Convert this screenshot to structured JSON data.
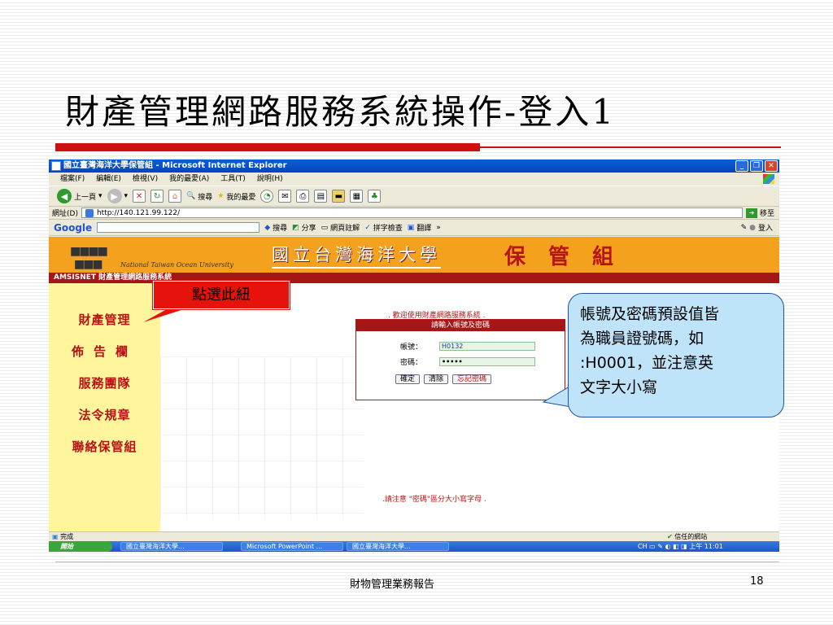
{
  "slide": {
    "title": "財產管理網路服務系統操作-登入1",
    "footer": "財物管理業務報告",
    "page_number": "18"
  },
  "browser": {
    "window_title": "國立臺灣海洋大學保管組 - Microsoft Internet Explorer",
    "menu": [
      "檔案(F)",
      "編輯(E)",
      "檢視(V)",
      "我的最愛(A)",
      "工具(T)",
      "說明(H)"
    ],
    "toolbar": {
      "back": "上一頁",
      "search": "搜尋",
      "favorites": "我的最愛"
    },
    "address_label": "網址(D)",
    "address_value": "http://140.121.99.122/",
    "go_label": "移至",
    "google": {
      "logo": "Google",
      "search": "搜尋",
      "share": "分享",
      "notes": "網頁註解",
      "spell": "拼字檢查",
      "translate": "翻譯",
      "more": "»",
      "signin": "登入"
    },
    "status_left": "完成",
    "status_right": "信任的網站"
  },
  "site": {
    "en_name": "National Taiwan Ocean University",
    "zh_name": "國立台灣海洋大學",
    "unit": "保管組",
    "subbar": "AMSISNET 財產管理網路服務系統",
    "nav": [
      "財產管理",
      "佈告欄",
      "服務團隊",
      "法令規章",
      "聯絡保管組"
    ],
    "welcome": ". 歡迎使用財產網路服務系統 .",
    "login_header": "請輸入帳號及密碼",
    "account_label": "帳號：",
    "account_value": "H0132",
    "password_label": "密碼：",
    "password_value": "•••••",
    "confirm": "確定",
    "clear": "清除",
    "forgot": "忘記密碼",
    "note": ".請注意 \"密碼\"區分大小寫字母 ."
  },
  "taskbar": {
    "start": "開始",
    "items": [
      "國立臺灣海洋大學...",
      "Microsoft PowerPoint ...",
      "國立臺灣海洋大學..."
    ],
    "lang": "CH",
    "time": "上午 11:01"
  },
  "callouts": {
    "click_here": "點選此紐",
    "info_lines": [
      "帳號及密碼預設值皆",
      "為職員證號碼，如",
      ":H0001，並注意英",
      "文字大小寫"
    ]
  },
  "colors": {
    "accent_red": "#cc1111",
    "site_orange": "#f4a11e",
    "nav_yellow": "#fff59c",
    "callout_blue": "#bfe3f8"
  }
}
